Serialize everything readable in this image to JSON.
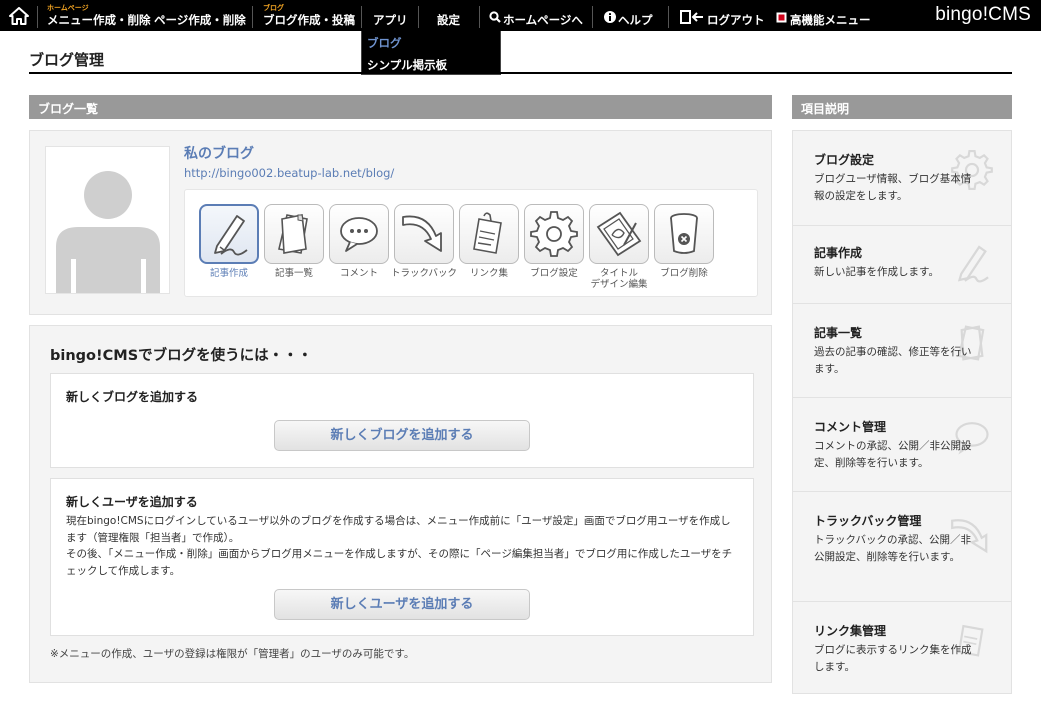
{
  "nav": {
    "home_icon": "home-icon",
    "items": [
      {
        "label": "メニュー作成・削除",
        "sup": "ホームページ"
      },
      {
        "label": "ページ作成・削除",
        "sup": ""
      },
      {
        "label": "ブログ作成・投稿",
        "sup": "ブログ"
      },
      {
        "label": "アプリ",
        "sup": ""
      },
      {
        "label": "設定",
        "sup": ""
      },
      {
        "label": "ホームページへ",
        "sup": ""
      },
      {
        "label": "ヘルプ",
        "sup": ""
      },
      {
        "label": "ログアウト",
        "sup": ""
      },
      {
        "label": "高機能メニュー",
        "sup": ""
      }
    ],
    "brand": "bingo!CMS"
  },
  "dropdown": {
    "options": [
      {
        "label": "ブログ",
        "color": "#6f93cf"
      },
      {
        "label": "シンプル掲示板",
        "color": "#ffffff"
      }
    ]
  },
  "page": {
    "title": "ブログ管理"
  },
  "blog_list": {
    "header": "ブログ一覧",
    "blog": {
      "name": "私のブログ",
      "url": "http://bingo002.beatup-lab.net/blog/"
    },
    "tools": [
      {
        "label": "記事作成",
        "icon": "pen-icon",
        "active": true
      },
      {
        "label": "記事一覧",
        "icon": "document-stack-icon",
        "active": false
      },
      {
        "label": "コメント",
        "icon": "speech-bubble-icon",
        "active": false
      },
      {
        "label": "トラックバック",
        "icon": "curved-arrow-icon",
        "active": false
      },
      {
        "label": "リンク集",
        "icon": "clipboard-icon",
        "active": false
      },
      {
        "label": "ブログ設定",
        "icon": "gear-icon",
        "active": false
      },
      {
        "label": "タイトル\nデザイン編集",
        "icon": "design-edit-icon",
        "active": false
      },
      {
        "label": "ブログ削除",
        "icon": "trash-icon",
        "active": false
      }
    ]
  },
  "howto": {
    "title": "bingo!CMSでブログを使うには・・・",
    "add_blog": {
      "title": "新しくブログを追加する",
      "button": "新しくブログを追加する"
    },
    "add_user": {
      "title": "新しくユーザを追加する",
      "body": "現在bingo!CMSにログインしているユーザ以外のブログを作成する場合は、メニュー作成前に「ユーザ設定」画面でブログ用ユーザを作成します（管理権限「担当者」で作成）。\nその後、「メニュー作成・削除」画面からブログ用メニューを作成しますが、その際に「ページ編集担当者」でブログ用に作成したユーザをチェックして作成します。",
      "button": "新しくユーザを追加する"
    },
    "note": "※メニューの作成、ユーザの登録は権限が「管理者」のユーザのみ可能です。"
  },
  "help": {
    "header": "項目説明",
    "items": [
      {
        "title": "ブログ設定",
        "desc": "ブログユーザ情報、ブログ基本情報の設定をします。",
        "icon": "gear-icon"
      },
      {
        "title": "記事作成",
        "desc": "新しい記事を作成します。",
        "icon": "pen-icon"
      },
      {
        "title": "記事一覧",
        "desc": "過去の記事の確認、修正等を行います。",
        "icon": "document-stack-icon"
      },
      {
        "title": "コメント管理",
        "desc": "コメントの承認、公開／非公開設定、削除等を行います。",
        "icon": "speech-bubble-icon"
      },
      {
        "title": "トラックバック管理",
        "desc": "トラックバックの承認、公開／非公開設定、削除等を行います。",
        "icon": "curved-arrow-icon"
      },
      {
        "title": "リンク集管理",
        "desc": "ブログに表示するリンク集を作成します。",
        "icon": "clipboard-icon"
      }
    ]
  },
  "colors": {
    "link": "#5b7db5",
    "accent_orange": "#f5a623",
    "section_bar": "#999999",
    "nav_bg": "#000000"
  }
}
